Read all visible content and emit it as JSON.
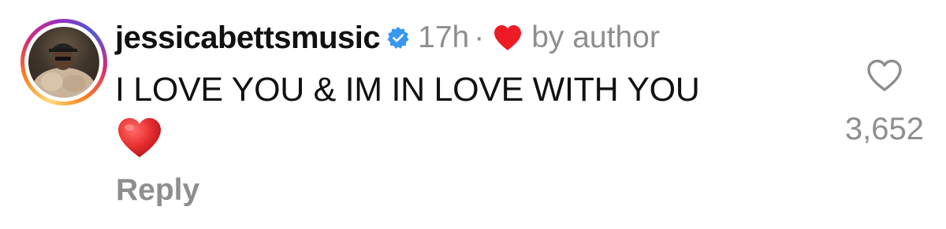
{
  "comment": {
    "username": "jessicabettsmusic",
    "verified_icon": "verified-badge-icon",
    "time_ago": "17h",
    "separator": "·",
    "liked_by_author_icon": "heart-icon",
    "liked_by_author_label": "by author",
    "text": "I LOVE YOU & IM IN LOVE WITH YOU",
    "emoji": "red-heart-emoji",
    "reply_label": "Reply",
    "like_icon": "heart-outline-icon",
    "like_count": "3,652"
  },
  "colors": {
    "text_primary": "#111111",
    "text_secondary": "#8e8e8e",
    "verified_blue": "#3897f0",
    "heart_red": "#ed1c24"
  }
}
